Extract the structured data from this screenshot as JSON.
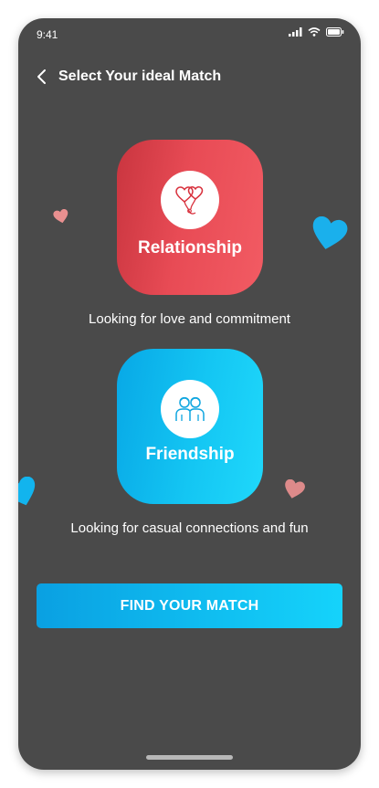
{
  "status_bar": {
    "time": "9:41"
  },
  "header": {
    "title": "Select Your ideal Match"
  },
  "options": [
    {
      "label": "Relationship",
      "description": "Looking for love and commitment",
      "icon": "hearts-balloon-icon",
      "color": "#e84b55"
    },
    {
      "label": "Friendship",
      "description": "Looking for casual connections and fun",
      "icon": "friends-icon",
      "color": "#14c6f3"
    }
  ],
  "cta": {
    "label": "FIND YOUR MATCH"
  },
  "colors": {
    "background": "#4a4a4a",
    "accent_red": "#e84b55",
    "accent_blue": "#14c6f3"
  }
}
